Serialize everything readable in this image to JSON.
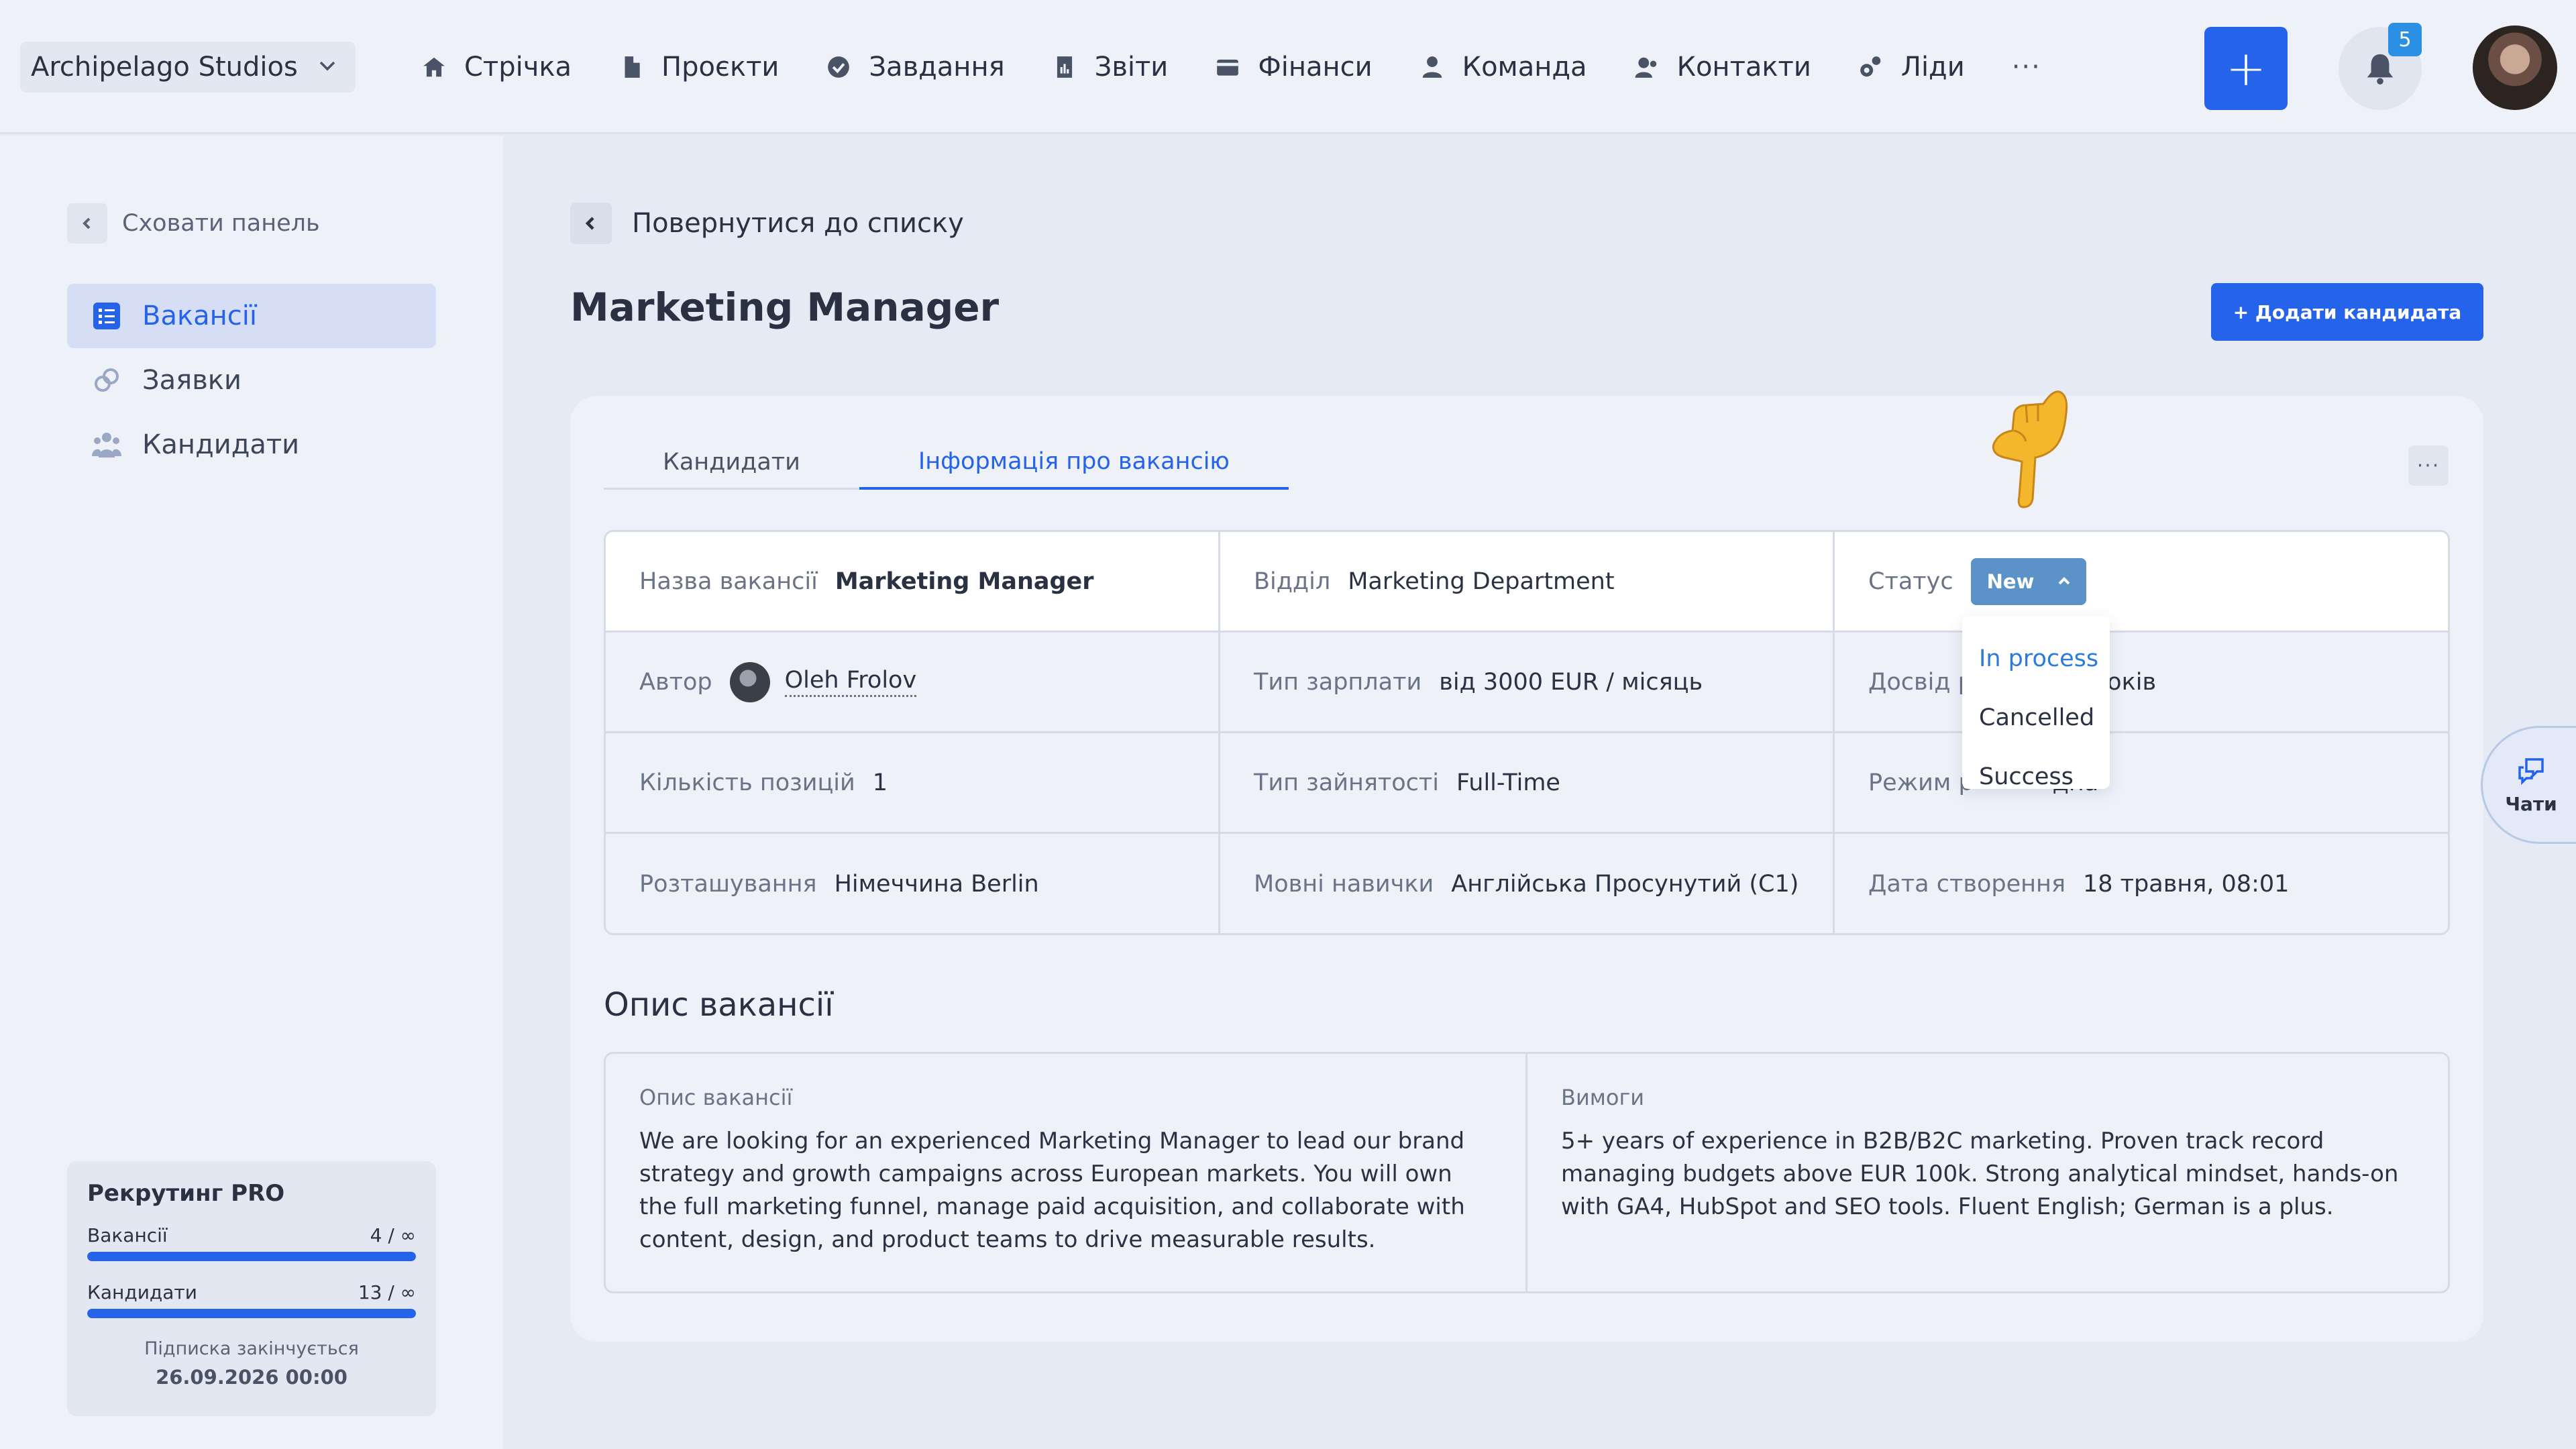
{
  "workspace": {
    "name": "Archipelago Studios"
  },
  "nav": {
    "items": [
      {
        "label": "Стрічка",
        "icon": "home-icon"
      },
      {
        "label": "Проєкти",
        "icon": "document-icon"
      },
      {
        "label": "Завдання",
        "icon": "check-circle-icon"
      },
      {
        "label": "Звіти",
        "icon": "report-icon"
      },
      {
        "label": "Фінанси",
        "icon": "wallet-icon"
      },
      {
        "label": "Команда",
        "icon": "user-icon"
      },
      {
        "label": "Контакти",
        "icon": "contacts-icon"
      },
      {
        "label": "Ліди",
        "icon": "leads-icon"
      }
    ],
    "more": "···",
    "add": "+",
    "notifications_count": "5"
  },
  "sidebar": {
    "hide_label": "Сховати панель",
    "items": [
      {
        "label": "Вакансії",
        "active": true
      },
      {
        "label": "Заявки",
        "active": false
      },
      {
        "label": "Кандидати",
        "active": false
      }
    ],
    "plan": {
      "title": "Рекрутинг PRO",
      "rows": [
        {
          "label": "Вакансії",
          "value": "4 / ∞",
          "fill": 1.0
        },
        {
          "label": "Кандидати",
          "value": "13 / ∞",
          "fill": 1.0
        }
      ],
      "note": "Підписка закінчується",
      "expires": "26.09.2026 00:00"
    }
  },
  "main": {
    "back_label": "Повернутися до списку",
    "title": "Marketing Manager",
    "add_candidate": "+ Додати кандидата",
    "tabs": [
      {
        "label": "Кандидати",
        "active": false
      },
      {
        "label": "Інформація про вакансію",
        "active": true
      }
    ],
    "more": "···",
    "info": {
      "name_label": "Назва вакансії",
      "name_value": "Marketing Manager",
      "dept_label": "Відділ",
      "dept_value": "Marketing Department",
      "status_label": "Статус",
      "status_value": "New",
      "author_label": "Автор",
      "author_value": "Oleh Frolov",
      "salary_label": "Тип зарплати",
      "salary_value": "від 3000 EUR / місяць",
      "exp_label": "Досвід р",
      "exp_value": "е 5 років",
      "positions_label": "Кількість позицій",
      "positions_value": "1",
      "employment_label": "Тип зайнятості",
      "employment_value": "Full-Time",
      "mode_label": "Режим р",
      "mode_value": "дна",
      "location_label": "Розташування",
      "location_value": "Німеччина Berlin",
      "lang_label": "Мовні навички",
      "lang_value": "Англійська Просунутий (С1)",
      "created_label": "Дата створення",
      "created_value": "18 травня, 08:01"
    },
    "status_options": [
      "In process",
      "Cancelled",
      "Success"
    ],
    "description": {
      "section_title": "Опис вакансії",
      "left_label": "Опис вакансії",
      "left_text": "We are looking for an experienced Marketing Manager to lead our brand strategy and growth campaigns across European markets. You will own the full marketing funnel, manage paid acquisition, and collaborate with content, design, and product teams to drive measurable results.",
      "right_label": "Вимоги",
      "right_text": "5+ years of experience in B2B/B2C marketing. Proven track record managing budgets above EUR 100k. Strong analytical mindset, hands-on with GA4, HubSpot and SEO tools. Fluent English; German is a plus."
    }
  },
  "chats_label": "Чати",
  "colors": {
    "accent": "#2563eb",
    "status_chip": "#5b93c8",
    "background": "#e6eaf5"
  }
}
